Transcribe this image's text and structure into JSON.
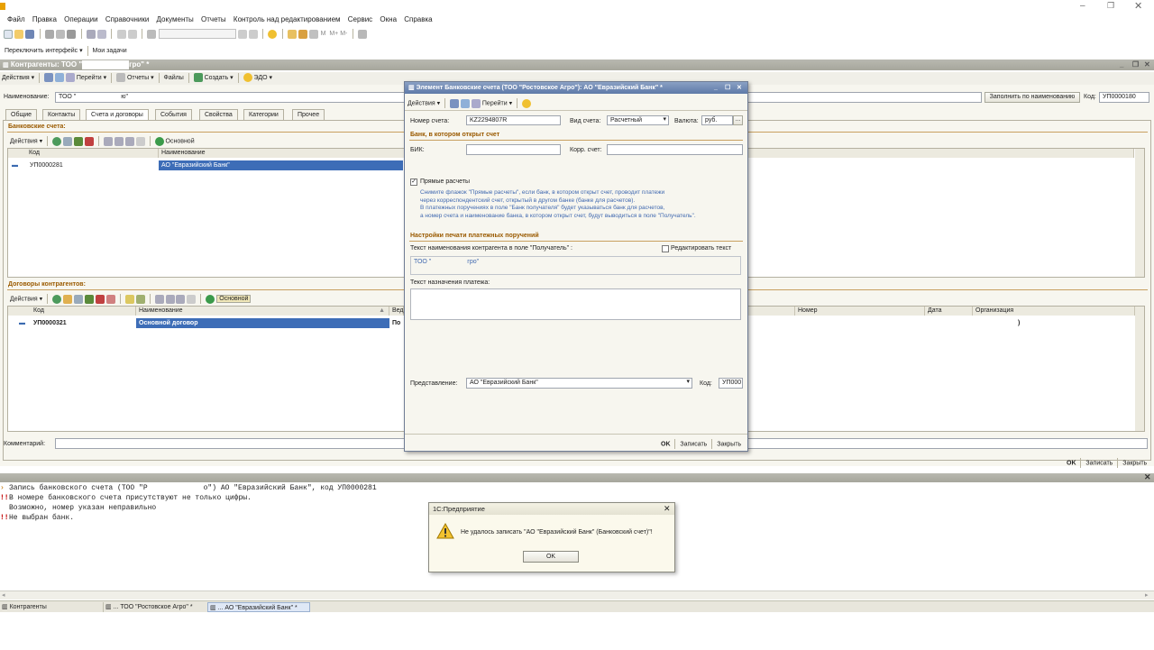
{
  "menubar": {
    "items": [
      "Файл",
      "Правка",
      "Операции",
      "Справочники",
      "Документы",
      "Отчеты",
      "Контроль над редактированием",
      "Сервис",
      "Окна",
      "Справка"
    ]
  },
  "panelbar": {
    "switch_label": "Переключить интерфейс",
    "tasks_label": "Мои задачи"
  },
  "counterparty": {
    "title": "Контрагенты: ТОО \"",
    "title_end": "гро\" *",
    "toolbar": {
      "actions": "Действия",
      "goto": "Перейти",
      "reports": "Отчеты",
      "files": "Файлы",
      "create": "Создать",
      "edo": "ЭДО"
    },
    "name_label": "Наименование:",
    "name_value": "ТОО \"",
    "name_value_end": "ю\"",
    "fill_button": "Заполнить по наименованию",
    "code_label": "Код:",
    "code_value": "УП0000180",
    "tabs": [
      "Общие",
      "Контакты",
      "Счета и договоры",
      "События",
      "Свойства",
      "Категории",
      "Прочее"
    ],
    "accounts": {
      "title": "Банковские счета:",
      "actions": "Действия",
      "main": "Основной",
      "col_code": "Код",
      "col_name": "Наименование",
      "row_code": "УП0000281",
      "row_name": "АО \"Евразийский Банк\""
    },
    "contracts": {
      "title": "Договоры контрагентов:",
      "actions": "Действия",
      "main": "Основной",
      "col_code": "Код",
      "col_name": "Наименование",
      "col_ved": "Вед",
      "col_num": "Номер",
      "col_date": "Дата",
      "col_org": "Организация",
      "row_code": "УП0000321",
      "row_name": "Основной договор",
      "row_ved": "По",
      "row_org": ")"
    },
    "comment_label": "Комментарий:",
    "ok": "OK",
    "write": "Записать",
    "close": "Закрыть"
  },
  "bank_dialog": {
    "title": "Элемент Банковские счета (ТОО \"Ростовское Агро\"): АО \"Евразийский Банк\" *",
    "toolbar": {
      "actions": "Действия",
      "goto": "Перейти"
    },
    "acc_no_label": "Номер счета:",
    "acc_no_value": "KZ2294807R",
    "acc_type_label": "Вид счета:",
    "acc_type_value": "Расчетный",
    "currency_label": "Валюта:",
    "currency_value": "руб.",
    "bank_section": "Банк, в котором открыт счет",
    "bik_label": "БИК:",
    "corr_label": "Корр. счет:",
    "direct_label": "Прямые расчеты",
    "hint": [
      "Снимите флажок \"Прямые расчеты\", если банк, в котором открыт счет, проводит платежи",
      "через корреспондентский счет, открытый в другом банке (банке для расчетов).",
      "В платежных поручениях в поле \"Банк получателя\" будет указываться банк для расчетов,",
      "а номер счета и наименование банка, в котором открыт счет, будут выводиться в поле \"Получатель\"."
    ],
    "print_section": "Настройки печати платежных поручений",
    "recipient_label": "Текст наименования контрагента в поле \"Получатель\" :",
    "edit_text_label": "Редактировать текст",
    "recipient_value": "ТОО \"",
    "recipient_value_end": "гро\"",
    "purpose_label": "Текст назначения платежа:",
    "repr_label": "Представление:",
    "repr_value": "АО \"Евразийский Банк\"",
    "code_label": "Код:",
    "code_value": "УП000",
    "ok": "OK",
    "write": "Записать",
    "close": "Закрыть"
  },
  "messages": [
    {
      "mark": "›",
      "text": "Запись банковского счета (ТОО \"Р"
    },
    {
      "mark": "!!",
      "text": "В номере банковского счета присутствуют не только цифры."
    },
    {
      "mark": "",
      "text": "Возможно, номер указан неправильно"
    },
    {
      "mark": "!!",
      "text": "Не выбран банк."
    }
  ],
  "message_tail": "о\") АО \"Евразийский Банк\", код УП0000281",
  "alert": {
    "title": "1С:Предприятие",
    "text": "Не удалось записать \"АО \"Евразийский Банк\" (Банковский счет)\"!",
    "ok": "OK"
  },
  "taskbar": {
    "items": [
      "Контрагенты",
      "... ТОО \"Ростовское Агро\" *",
      "... АО \"Евразийский Банк\" *"
    ]
  }
}
